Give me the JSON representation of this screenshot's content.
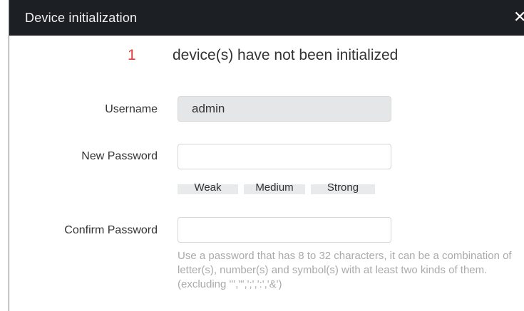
{
  "dialog": {
    "title": "Device initialization",
    "close_icon": "close-icon"
  },
  "status": {
    "count": "1",
    "message": "device(s) have not been initialized"
  },
  "form": {
    "username": {
      "label": "Username",
      "value": "admin"
    },
    "new_password": {
      "label": "New Password",
      "value": ""
    },
    "strength": {
      "weak": "Weak",
      "medium": "Medium",
      "strong": "Strong"
    },
    "confirm_password": {
      "label": "Confirm Password",
      "value": ""
    },
    "hint": "Use a password that has 8 to 32 characters, it can be a combination of letter(s), number(s) and symbol(s) with at least two kinds of them. (excluding ''','\",';',':','&')"
  },
  "colors": {
    "titlebar": "#1c1f24",
    "count": "#e23b3b",
    "hint": "#aaaaaa"
  }
}
